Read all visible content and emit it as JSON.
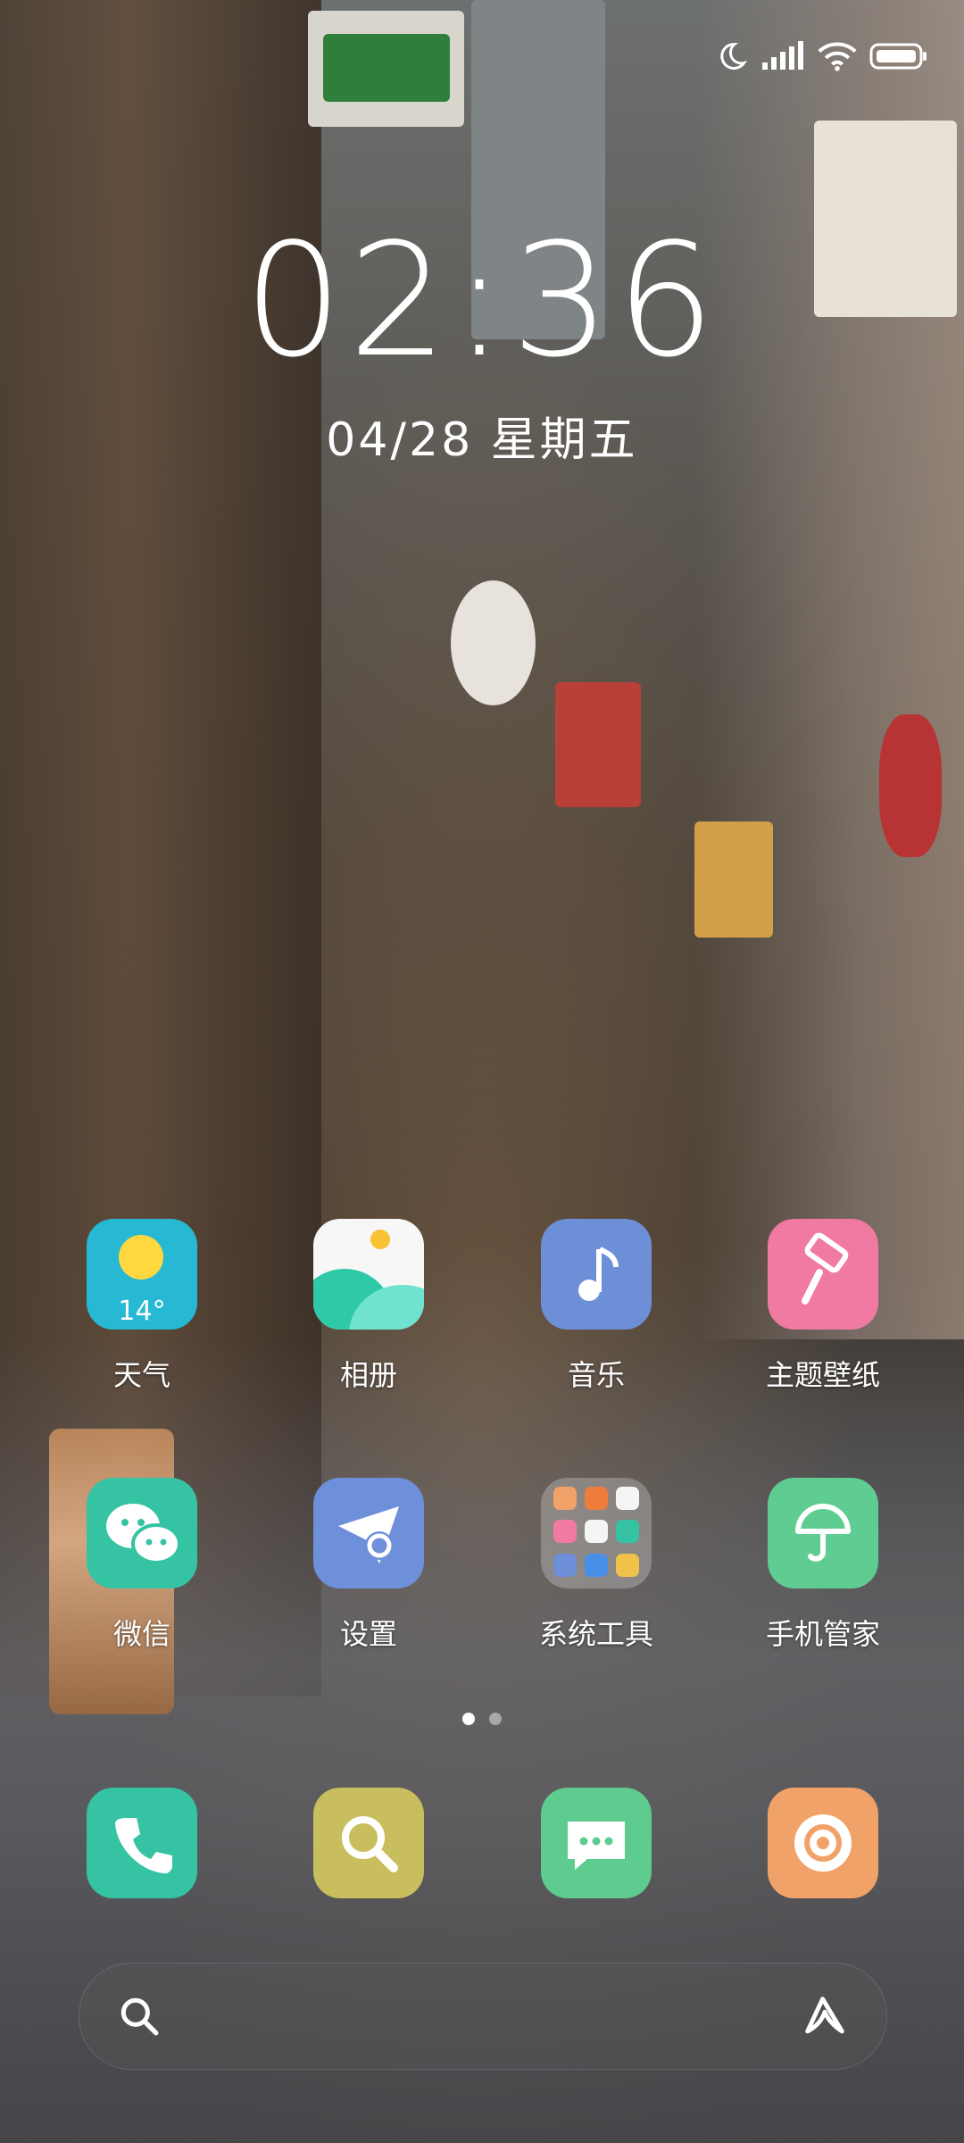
{
  "status_bar": {
    "icons": [
      "moon-icon",
      "signal-icon",
      "wifi-icon",
      "battery-icon"
    ]
  },
  "lockscreen": {
    "time": "02:36",
    "date": "04/28 星期五"
  },
  "apps_row1": [
    {
      "label": "天气",
      "icon": "weather-icon",
      "badge_text": "14°",
      "color": "#27b8d3"
    },
    {
      "label": "相册",
      "icon": "gallery-icon",
      "color": "#38c9b3"
    },
    {
      "label": "音乐",
      "icon": "music-icon",
      "color": "#6d8fd8"
    },
    {
      "label": "主题壁纸",
      "icon": "theme-icon",
      "color": "#f07aa1"
    }
  ],
  "apps_row2": [
    {
      "label": "微信",
      "icon": "wechat-icon",
      "color": "#35c3a3"
    },
    {
      "label": "设置",
      "icon": "settings-icon",
      "color": "#6e8fd9"
    },
    {
      "label": "系统工具",
      "icon": "folder-icon",
      "color": "rgba(255,255,255,0.25)"
    },
    {
      "label": "手机管家",
      "icon": "security-icon",
      "color": "#5fcc92"
    }
  ],
  "page_indicator": {
    "total": 2,
    "active": 1
  },
  "dock": [
    {
      "icon": "phone-icon",
      "color": "#35c3a3"
    },
    {
      "icon": "browser-search-icon",
      "color": "#c9be5d"
    },
    {
      "icon": "messages-icon",
      "color": "#5ecb8f"
    },
    {
      "icon": "camera-icon",
      "color": "#f0a269"
    }
  ],
  "search_bar": {
    "left_icon": "search-icon",
    "right_icon": "assistant-icon"
  }
}
